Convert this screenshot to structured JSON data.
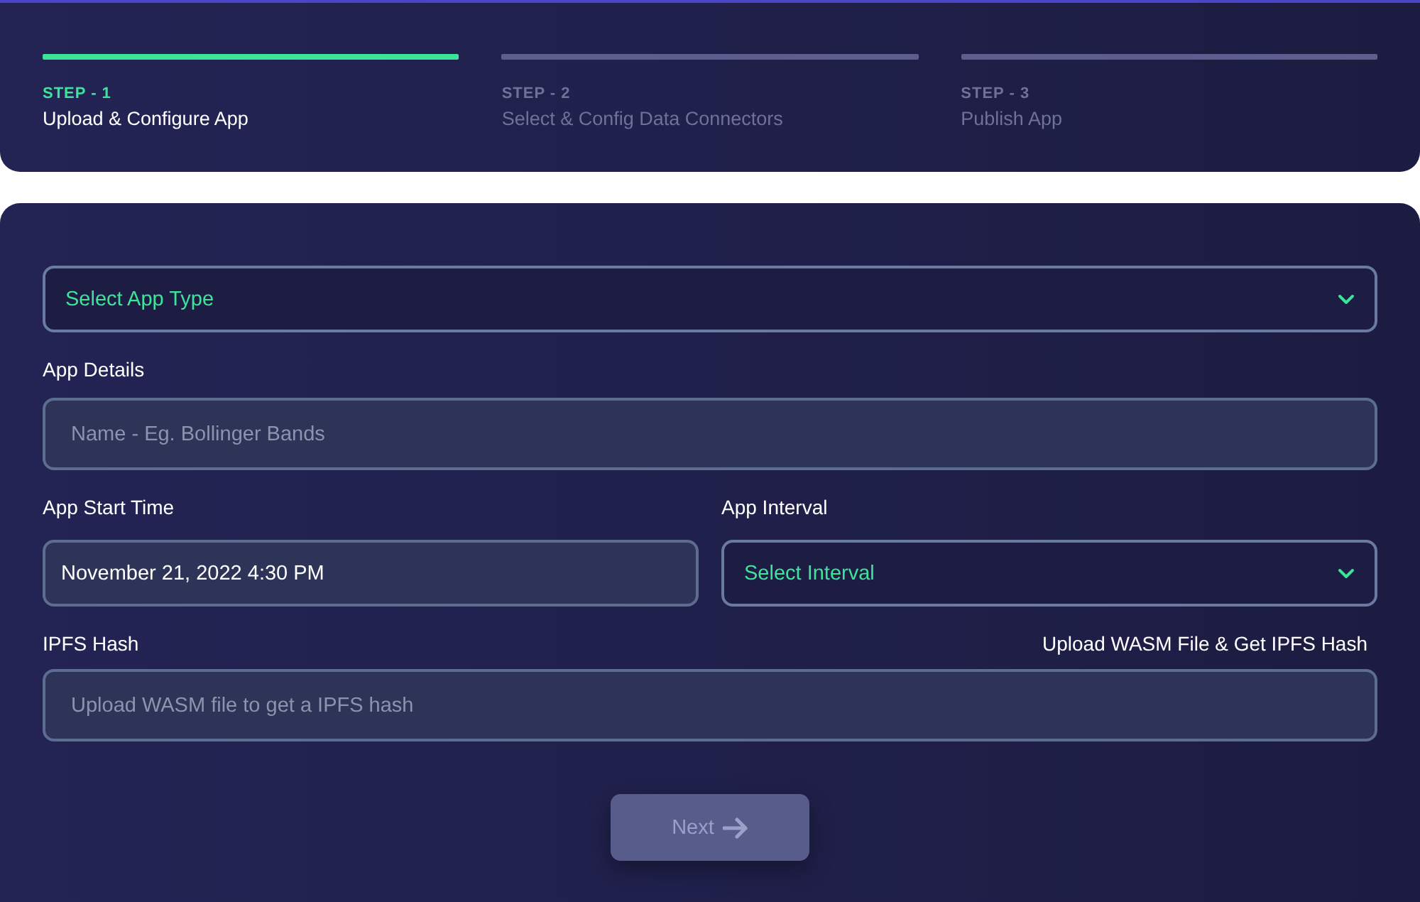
{
  "steps": [
    {
      "label": "STEP - 1",
      "title": "Upload & Configure App",
      "selected": true
    },
    {
      "label": "STEP - 2",
      "title": "Select & Config Data Connectors",
      "selected": false
    },
    {
      "label": "STEP - 3",
      "title": "Publish App",
      "selected": false
    }
  ],
  "app_type": {
    "value": "Select App Type"
  },
  "app_details": {
    "label": "App Details",
    "placeholder": "Name - Eg. Bollinger Bands"
  },
  "app_start_time": {
    "label": "App Start Time",
    "value": "November 21, 2022 4:30 PM"
  },
  "app_interval": {
    "label": "App Interval",
    "value": "Select Interval"
  },
  "ipfs_hash": {
    "label": "IPFS Hash",
    "link": "Upload WASM File & Get IPFS Hash",
    "placeholder": "Upload WASM file to get a IPFS hash"
  },
  "next_button": {
    "label": "Next",
    "disabled": true
  }
}
